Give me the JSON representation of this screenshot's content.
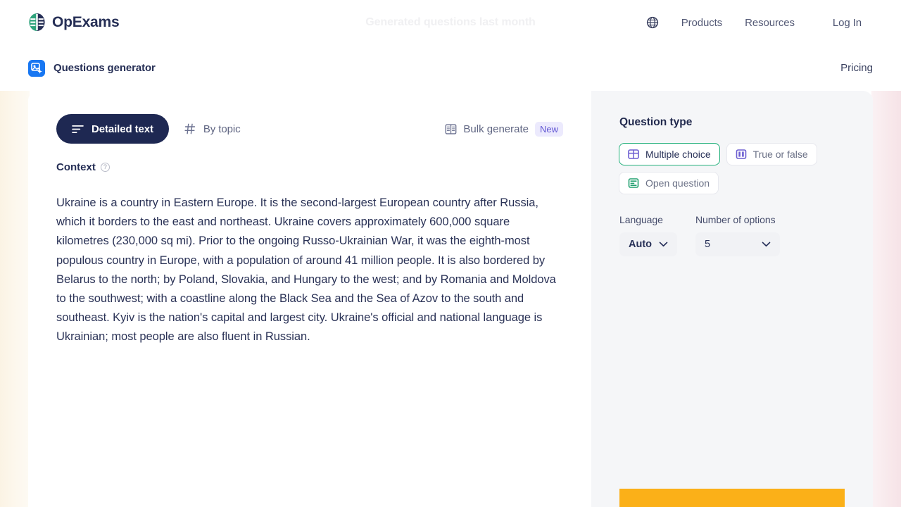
{
  "topnav": {
    "brand_name": "OpExams",
    "banner_text": "Generated questions last month",
    "globe_icon": "globe-icon",
    "links": [
      {
        "label": "Products"
      },
      {
        "label": "Resources"
      }
    ],
    "login_label": "Log In"
  },
  "subnav": {
    "app_icon": "questions-generator-icon",
    "app_title": "Questions generator",
    "pricing_label": "Pricing"
  },
  "main": {
    "tabs": [
      {
        "label": "Detailed text",
        "icon": "text-lines-icon",
        "active": true
      },
      {
        "label": "By topic",
        "icon": "hash-icon",
        "active": false
      }
    ],
    "bulk": {
      "icon": "book-open-icon",
      "label": "Bulk generate",
      "badge": "New"
    },
    "context": {
      "label": "Context",
      "help_icon": "question-mark-circle-icon",
      "value": "Ukraine is a country in Eastern Europe. It is the second-largest European country after Russia, which it borders to the east and northeast. Ukraine covers approximately 600,000 square kilometres (230,000 sq mi). Prior to the ongoing Russo-Ukrainian War, it was the eighth-most populous country in Europe, with a population of around 41 million people. It is also bordered by Belarus to the north; by Poland, Slovakia, and Hungary to the west; and by Romania and Moldova to the southwest; with a coastline along the Black Sea and the Sea of Azov to the south and southeast. Kyiv is the nation's capital and largest city. Ukraine's official and national language is Ukrainian; most people are also fluent in Russian."
    }
  },
  "sidebar": {
    "question_type": {
      "heading": "Question type",
      "options": [
        {
          "label": "Multiple choice",
          "icon": "grid-table-icon",
          "selected": true
        },
        {
          "label": "True or false",
          "icon": "two-columns-icon",
          "selected": false
        },
        {
          "label": "Open question",
          "icon": "paragraph-lines-icon",
          "selected": false
        }
      ]
    },
    "language": {
      "label": "Language",
      "value": "Auto",
      "chevron_icon": "chevron-down-icon"
    },
    "number_of_options": {
      "label": "Number of options",
      "value": "5",
      "chevron_icon": "chevron-down-icon"
    },
    "generate_button": {
      "label": ""
    }
  },
  "colors": {
    "navy": "#1e2852",
    "green": "#21b07a",
    "purple": "#6257d3",
    "amber": "#fbb018",
    "panel": "#f5f6f8",
    "blue": "#1877f2"
  }
}
